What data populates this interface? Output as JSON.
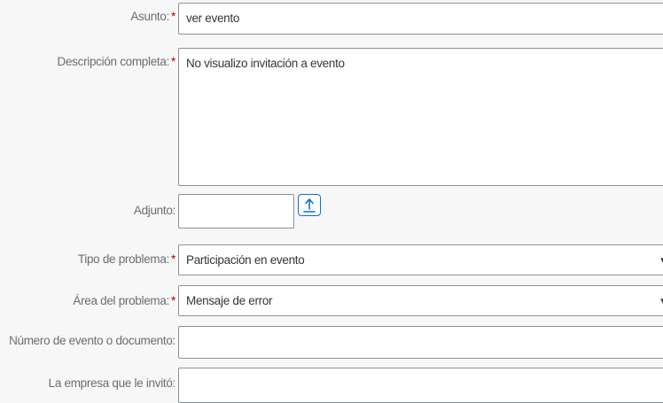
{
  "form": {
    "asunto": {
      "label": "Asunto:",
      "value": "ver evento",
      "required_mark": "*"
    },
    "descripcion": {
      "label": "Descripción completa:",
      "value": "No visualizo invitación a evento",
      "required_mark": "*"
    },
    "adjunto": {
      "label": "Adjunto:",
      "value": "",
      "upload_icon": "upload-icon"
    },
    "tipo_problema": {
      "label": "Tipo de problema:",
      "value": "Participación en evento",
      "required_mark": "*"
    },
    "area_problema": {
      "label": "Área del problema:",
      "value": "Mensaje de error",
      "required_mark": "*"
    },
    "numero_evento": {
      "label": "Número de evento o documento:",
      "value": ""
    },
    "empresa": {
      "label": "La empresa que le invitó:",
      "value": ""
    }
  },
  "colors": {
    "required": "#bb0000",
    "accent": "#0a6ed1",
    "label": "#6a6d70",
    "border": "#89919a",
    "background": "#f7f7f7"
  }
}
